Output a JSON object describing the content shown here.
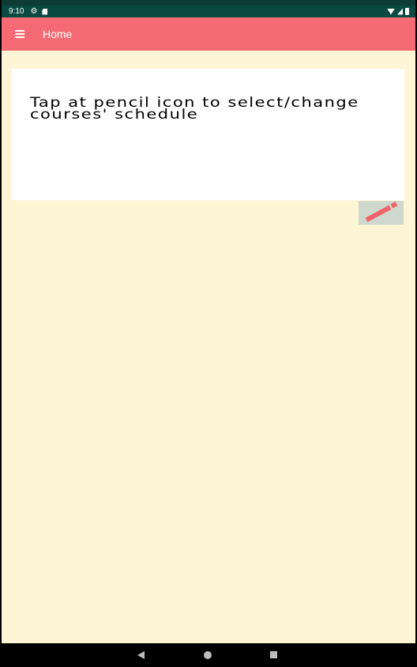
{
  "status_bar": {
    "time": "9:10",
    "icons": [
      "gear-icon",
      "sd-card-icon",
      "wifi-icon",
      "signal-icon",
      "battery-icon"
    ]
  },
  "app_bar": {
    "title": "Home",
    "menu_icon": "menu-icon",
    "color": "#f66b73"
  },
  "main": {
    "instruction": "Tap at pencil icon to select/change courses' schedule",
    "edit_icon": "pencil-icon",
    "background": "#fef4d6"
  },
  "nav_bar": {
    "buttons": [
      "back-icon",
      "home-icon",
      "recents-icon"
    ]
  }
}
